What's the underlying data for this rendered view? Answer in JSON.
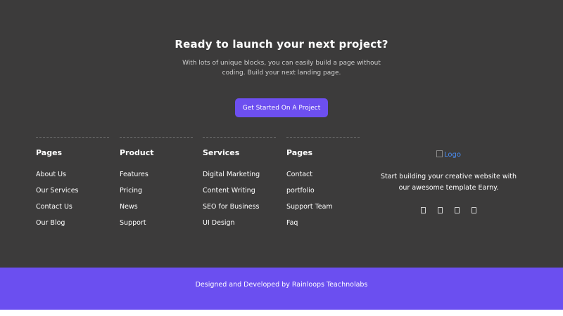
{
  "cta": {
    "title": "Ready to launch your next project?",
    "subtitle": "With lots of unique blocks, you can easily build a page without coding. Build your next landing page.",
    "button_label": "Get Started On A Project"
  },
  "columns": [
    {
      "heading": "Pages",
      "links": [
        "About Us",
        "Our Services",
        "Contact Us",
        "Our Blog"
      ]
    },
    {
      "heading": "Product",
      "links": [
        "Features",
        "Pricing",
        "News",
        "Support"
      ]
    },
    {
      "heading": "Services",
      "links": [
        "Digital Marketing",
        "Content Writing",
        "SEO for Business",
        "UI Design"
      ]
    },
    {
      "heading": "Pages",
      "links": [
        "Contact",
        "portfolio",
        "Support Team",
        "Faq"
      ]
    }
  ],
  "brand": {
    "logo_alt": "Logo",
    "tagline": "Start building your creative website with our awesome template Earny.",
    "social_icons": [
      "facebook-icon",
      "twitter-icon",
      "instagram-icon",
      "linkedin-icon"
    ]
  },
  "footer": {
    "credit_prefix": "Designed and Developed by",
    "credit_company": "Rainloops Teachnolabs"
  },
  "colors": {
    "dark_bg": "#3c3b3b",
    "accent": "#6d4ff0",
    "footer_bg": "#6b4ff0"
  }
}
